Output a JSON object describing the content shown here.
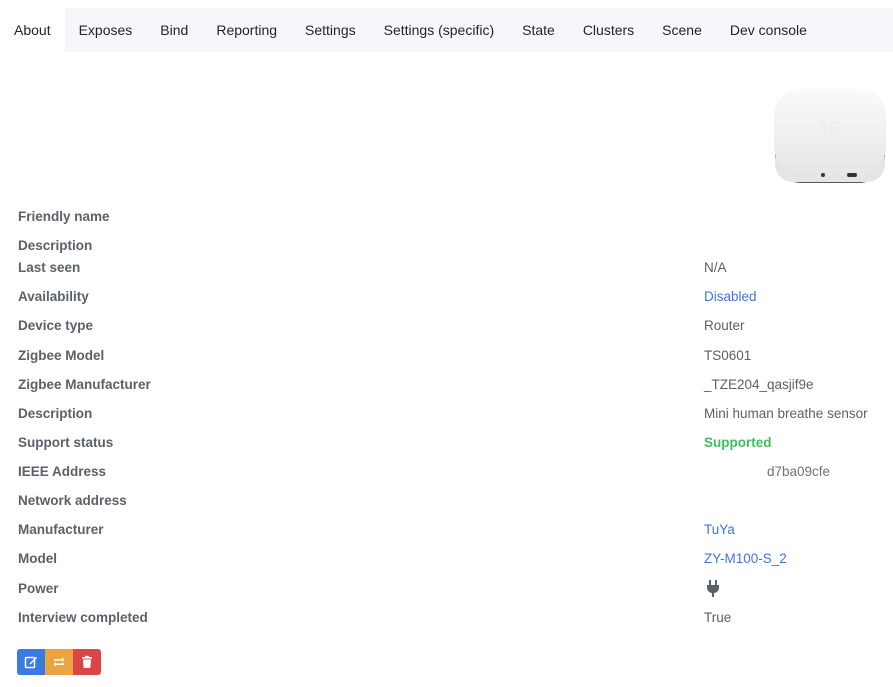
{
  "tabs": [
    "About",
    "Exposes",
    "Bind",
    "Reporting",
    "Settings",
    "Settings (specific)",
    "State",
    "Clusters",
    "Scene",
    "Dev console"
  ],
  "properties": {
    "friendly_name": {
      "label": "Friendly name",
      "value": ""
    },
    "description_top": {
      "label": "Description",
      "value": ""
    },
    "last_seen": {
      "label": "Last seen",
      "value": "N/A"
    },
    "availability": {
      "label": "Availability",
      "value": "Disabled"
    },
    "device_type": {
      "label": "Device type",
      "value": "Router"
    },
    "zigbee_model": {
      "label": "Zigbee Model",
      "value": "TS0601"
    },
    "zigbee_manufacturer": {
      "label": "Zigbee Manufacturer",
      "value": "_TZE204_qasjif9e"
    },
    "description": {
      "label": "Description",
      "value": "Mini human breathe sensor"
    },
    "support_status": {
      "label": "Support status",
      "value": "Supported"
    },
    "ieee_address": {
      "label": "IEEE Address",
      "value": "d7ba09cfe"
    },
    "network_address": {
      "label": "Network address",
      "value": ""
    },
    "manufacturer": {
      "label": "Manufacturer",
      "value": "TuYa"
    },
    "model": {
      "label": "Model",
      "value": "ZY-M100-S_2"
    },
    "power": {
      "label": "Power",
      "icon": "plug-icon"
    },
    "interview_completed": {
      "label": "Interview completed",
      "value": "True"
    }
  },
  "colors": {
    "link": "#3f77d6",
    "supported": "#3fbf5a",
    "edit": "#3a7be0",
    "reconfigure": "#eba442",
    "remove": "#dc4545"
  },
  "actions": {
    "edit_icon": "edit-icon",
    "reconfigure_icon": "refresh-icon",
    "remove_icon": "trash-icon"
  }
}
